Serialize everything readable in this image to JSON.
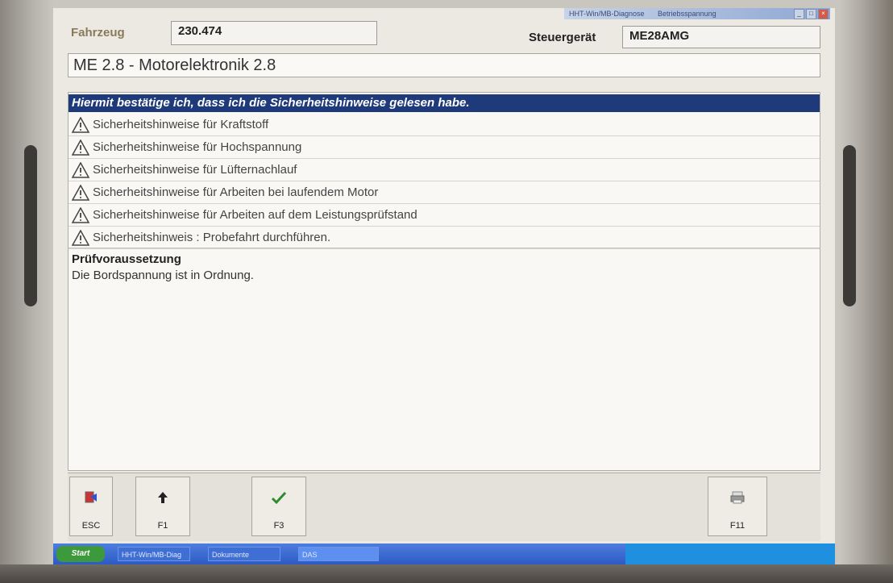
{
  "window": {
    "title": "HHT-Win/MB-Diagnose",
    "tray_text": "Betriebsspannung"
  },
  "header": {
    "vehicle_label": "Fahrzeug",
    "vehicle_value": "230.474",
    "ecu_label": "Steuergerät",
    "ecu_value": "ME28AMG"
  },
  "module_title": "ME 2.8 - Motorelektronik 2.8",
  "confirm_bar": "Hiermit bestätige ich, dass ich die Sicherheitshinweise gelesen habe.",
  "safety_items": [
    {
      "icon": "warning-triangle-icon",
      "label": "Sicherheitshinweise für Kraftstoff"
    },
    {
      "icon": "warning-triangle-icon",
      "label": "Sicherheitshinweise für Hochspannung"
    },
    {
      "icon": "warning-triangle-icon",
      "label": "Sicherheitshinweise für Lüfternachlauf"
    },
    {
      "icon": "warning-triangle-icon",
      "label": "Sicherheitshinweise für Arbeiten bei laufendem Motor"
    },
    {
      "icon": "warning-triangle-icon",
      "label": "Sicherheitshinweise für Arbeiten auf dem Leistungsprüfstand"
    },
    {
      "icon": "warning-triangle-icon",
      "label": "Sicherheitshinweis : Probefahrt durchführen."
    }
  ],
  "precondition": {
    "heading": "Prüfvoraussetzung",
    "text": "Die Bordspannung ist in Ordnung."
  },
  "function_keys": [
    {
      "key": "ESC",
      "icon": "exit-icon"
    },
    {
      "key": "F1",
      "icon": "arrow-up-icon"
    },
    {
      "key": "F3",
      "icon": "checkmark-icon"
    },
    {
      "key": "F11",
      "icon": "printer-icon"
    }
  ],
  "taskbar": {
    "start_label": "Start",
    "tasks": [
      "HHT-Win/MB-Diag",
      "Dokumente",
      "DAS"
    ]
  },
  "colors": {
    "confirm_bar_bg": "#1f3a7a",
    "warning_icon": "#444444",
    "checkmark": "#2e8b2e"
  }
}
